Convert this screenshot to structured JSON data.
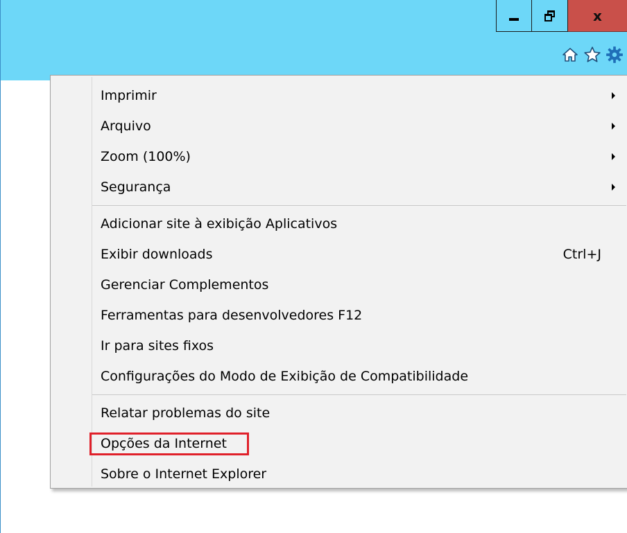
{
  "colors": {
    "titlebar": "#6dd7f8",
    "close_button": "#c9504a",
    "menu_background": "#f2f2f2",
    "highlight": "#e0202a"
  },
  "caption_buttons": {
    "minimize_icon": "minimize-icon",
    "restore_icon": "restore-icon",
    "close_label": "x"
  },
  "toolbar": {
    "home_icon": "home-icon",
    "favorites_icon": "star-icon",
    "tools_icon": "gear-icon"
  },
  "menu": {
    "group1": [
      {
        "label": "Imprimir",
        "submenu": true
      },
      {
        "label": "Arquivo",
        "submenu": true
      },
      {
        "label": "Zoom (100%)",
        "submenu": true
      },
      {
        "label": "Segurança",
        "submenu": true
      }
    ],
    "group2": [
      {
        "label": "Adicionar site à exibição Aplicativos"
      },
      {
        "label": "Exibir downloads",
        "shortcut": "Ctrl+J"
      },
      {
        "label": "Gerenciar Complementos"
      },
      {
        "label": "Ferramentas para desenvolvedores F12"
      },
      {
        "label": "Ir para sites fixos"
      },
      {
        "label": "Configurações do Modo de Exibição de Compatibilidade"
      }
    ],
    "group3": [
      {
        "label": "Relatar problemas do site"
      },
      {
        "label": "Opções da Internet",
        "highlighted": true
      },
      {
        "label": "Sobre o Internet Explorer"
      }
    ]
  }
}
